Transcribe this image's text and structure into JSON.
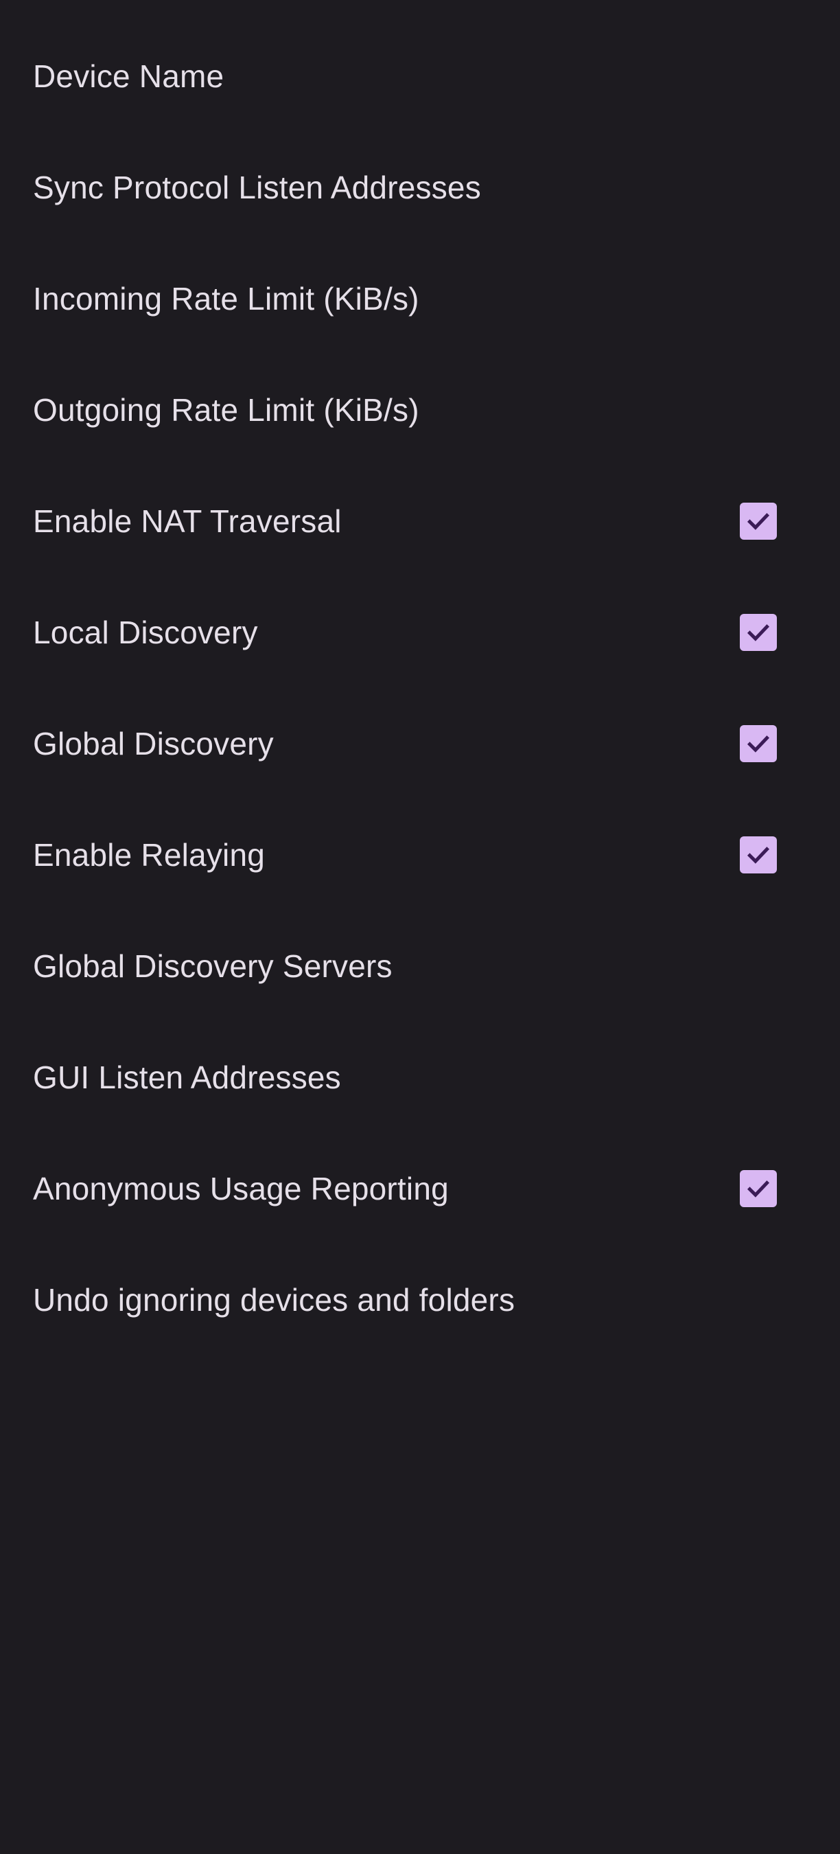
{
  "settings": {
    "items": [
      {
        "label": "Device Name",
        "checkbox": false
      },
      {
        "label": "Sync Protocol Listen Addresses",
        "checkbox": false
      },
      {
        "label": "Incoming Rate Limit (KiB/s)",
        "checkbox": false
      },
      {
        "label": "Outgoing Rate Limit (KiB/s)",
        "checkbox": false
      },
      {
        "label": "Enable NAT Traversal",
        "checkbox": true,
        "checked": true
      },
      {
        "label": "Local Discovery",
        "checkbox": true,
        "checked": true
      },
      {
        "label": "Global Discovery",
        "checkbox": true,
        "checked": true
      },
      {
        "label": "Enable Relaying",
        "checkbox": true,
        "checked": true
      },
      {
        "label": "Global Discovery Servers",
        "checkbox": false
      },
      {
        "label": "GUI Listen Addresses",
        "checkbox": false
      },
      {
        "label": "Anonymous Usage Reporting",
        "checkbox": true,
        "checked": true
      },
      {
        "label": "Undo ignoring devices and folders",
        "checkbox": false
      }
    ]
  },
  "colors": {
    "background": "#1d1b20",
    "text": "#e6e0e9",
    "checkbox_fill": "#d9b8f3",
    "checkmark": "#3b1b57"
  },
  "icons": {
    "checkbox": "check-icon"
  }
}
